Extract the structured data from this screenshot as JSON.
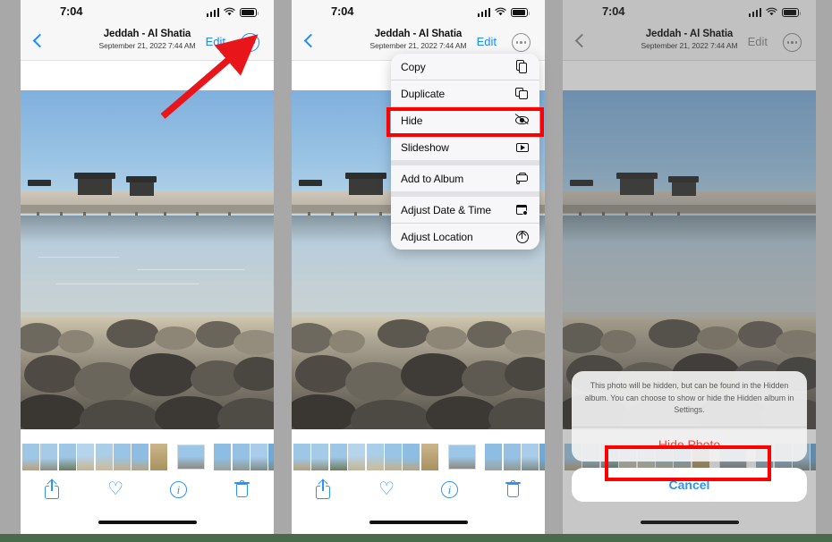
{
  "statusbar": {
    "time": "7:04",
    "signal_icon": "cellular-signal-icon",
    "wifi_icon": "wifi-icon",
    "battery_icon": "battery-icon"
  },
  "navbar": {
    "back_icon": "chevron-left-icon",
    "title": "Jeddah - Al Shatia",
    "subtitle": "September 21, 2022  7:44 AM",
    "edit_label": "Edit",
    "more_icon": "ellipsis-circle-icon"
  },
  "toolbar": {
    "share_icon": "share-icon",
    "favorite_icon": "heart-icon",
    "info_icon": "info-circle-icon",
    "delete_icon": "trash-icon"
  },
  "context_menu": {
    "items": [
      {
        "label": "Copy",
        "icon": "copy-icon"
      },
      {
        "label": "Duplicate",
        "icon": "duplicate-icon"
      },
      {
        "label": "Hide",
        "icon": "eye-slash-icon"
      },
      {
        "label": "Slideshow",
        "icon": "slideshow-icon"
      },
      {
        "label": "Add to Album",
        "icon": "add-to-album-icon"
      },
      {
        "label": "Adjust Date & Time",
        "icon": "calendar-clock-icon"
      },
      {
        "label": "Adjust Location",
        "icon": "location-circle-icon"
      }
    ]
  },
  "action_sheet": {
    "message": "This photo will be hidden, but can be found in the Hidden album. You can choose to show or hide the Hidden album in Settings.",
    "confirm_label": "Hide Photo",
    "cancel_label": "Cancel"
  },
  "annotations": {
    "arrow_color": "#e8161a",
    "highlight_color": "#ff0000",
    "arrow_target": "ellipsis-circle-icon",
    "highlights": [
      "Hide",
      "Hide Photo"
    ]
  },
  "photo": {
    "alt": "Seaside pier with wooden huts over shallow water and rocky shore",
    "panels": [
      "step-1-open-menu",
      "step-2-choose-hide",
      "step-3-confirm-hide"
    ]
  },
  "colors": {
    "accent_blue": "#2f93f0",
    "destructive_red": "#ff3b30",
    "page_background": "#a8a8a8",
    "bottom_strip": "#4a6b4a"
  }
}
